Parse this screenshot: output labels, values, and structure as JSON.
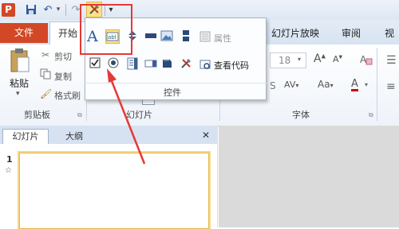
{
  "app": {
    "logo_letter": "P"
  },
  "qat": {
    "dropdown_arrow": "▾"
  },
  "tabs": {
    "file": "文件",
    "home": "开始",
    "slideshow": "幻灯片放映",
    "review": "审阅",
    "view": "视图"
  },
  "ribbon": {
    "paste_label": "粘贴",
    "cut_label": "剪切",
    "copy_label": "复制",
    "format_painter_label": "格式刷",
    "clipboard_group": "剪贴板",
    "slides_group": "幻灯片",
    "font_group": "字体",
    "font_size": "18",
    "char_spacing": "AV",
    "font_grow": "A",
    "font_shrink": "A",
    "font_color": "A",
    "aa": "Aa"
  },
  "controls_dropdown": {
    "label_a": "A",
    "properties_label": "属性",
    "view_code_label": "查看代码",
    "group_label": "控件"
  },
  "pane": {
    "tab_slides": "幻灯片",
    "tab_outline": "大纲",
    "close": "✕",
    "slide_number": "1",
    "slide_star": "☆"
  },
  "colors": {
    "accent": "#d24726",
    "annotation": "#e53935"
  }
}
